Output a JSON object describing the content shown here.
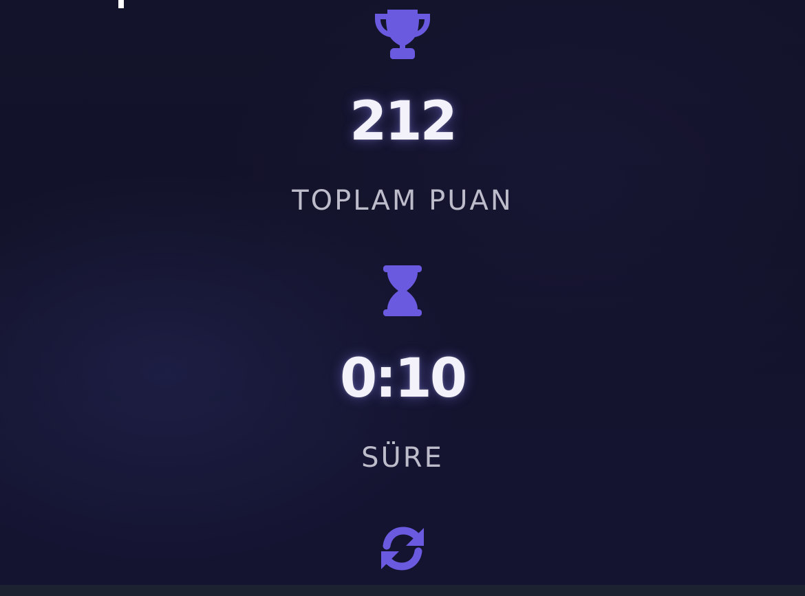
{
  "score": {
    "value": "212",
    "label": "TOPLAM PUAN",
    "icon": "trophy-icon"
  },
  "time": {
    "value": "0:10",
    "label": "SÜRE",
    "icon": "hourglass-icon"
  },
  "actions": {
    "restart_icon": "refresh-icon"
  },
  "colors": {
    "accent": "#6a5ae0",
    "background": "#13132b",
    "value_text": "#f3f2fb",
    "label_text": "#bdbccb",
    "bottom_bar": "#1d2230"
  }
}
